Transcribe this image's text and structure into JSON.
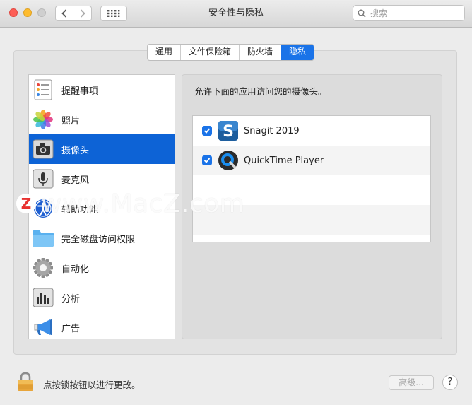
{
  "window": {
    "title": "安全性与隐私"
  },
  "search": {
    "placeholder": "搜索"
  },
  "tabs": [
    {
      "label": "通用",
      "active": false
    },
    {
      "label": "文件保险箱",
      "active": false
    },
    {
      "label": "防火墙",
      "active": false
    },
    {
      "label": "隐私",
      "active": true
    }
  ],
  "sidebar": {
    "items": [
      {
        "label": "提醒事项",
        "icon": "reminders-icon"
      },
      {
        "label": "照片",
        "icon": "photos-icon"
      },
      {
        "label": "摄像头",
        "icon": "camera-icon",
        "selected": true
      },
      {
        "label": "麦克风",
        "icon": "microphone-icon"
      },
      {
        "label": "辅助功能",
        "icon": "accessibility-icon"
      },
      {
        "label": "完全磁盘访问权限",
        "icon": "folder-icon"
      },
      {
        "label": "自动化",
        "icon": "gear-icon"
      },
      {
        "label": "分析",
        "icon": "analytics-icon"
      },
      {
        "label": "广告",
        "icon": "megaphone-icon"
      }
    ]
  },
  "pane": {
    "description": "允许下面的应用访问您的摄像头。",
    "apps": [
      {
        "name": "Snagit 2019",
        "checked": true,
        "icon": "snagit-icon"
      },
      {
        "name": "QuickTime Player",
        "checked": true,
        "icon": "quicktime-icon"
      }
    ]
  },
  "watermark": {
    "text": "www.MacZ.com",
    "logo_letter": "Z"
  },
  "footer": {
    "lock_text": "点按锁按钮以进行更改。",
    "advanced_label": "高级...",
    "help_label": "?"
  },
  "colors": {
    "accent": "#1a73e8",
    "selection": "#0d63d6"
  }
}
